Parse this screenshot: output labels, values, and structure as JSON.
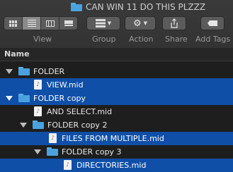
{
  "window": {
    "title": "CAN WIN 11 DO THIS PLZZZ"
  },
  "toolbar": {
    "view_label": "View",
    "group_label": "Group",
    "action_label": "Action",
    "share_label": "Share",
    "add_tags_label": "Add Tags",
    "view_modes": [
      "icon-view",
      "list-view",
      "column-view",
      "gallery-view"
    ],
    "active_view": "list-view"
  },
  "list": {
    "column_header": "Name",
    "rows": [
      {
        "name": "FOLDER",
        "kind": "folder",
        "depth": 0,
        "expanded": true,
        "selected": false
      },
      {
        "name": "VIEW.mid",
        "kind": "file",
        "depth": 1,
        "selected": true
      },
      {
        "name": "FOLDER copy",
        "kind": "folder",
        "depth": 0,
        "expanded": true,
        "selected": true
      },
      {
        "name": "AND SELECT.mid",
        "kind": "file",
        "depth": 1,
        "selected": false
      },
      {
        "name": "FOLDER copy 2",
        "kind": "folder",
        "depth": 1,
        "expanded": true,
        "selected": false
      },
      {
        "name": "FILES FROM MULTIPLE.mid",
        "kind": "file",
        "depth": 2,
        "selected": true
      },
      {
        "name": "FOLDER copy 3",
        "kind": "folder",
        "depth": 2,
        "expanded": true,
        "selected": false
      },
      {
        "name": "DIRECTORIES.mid",
        "kind": "file",
        "depth": 3,
        "selected": true
      }
    ]
  },
  "colors": {
    "selection": "#0f4fa8",
    "folder": "#49a2de",
    "background": "#1e1e1e"
  }
}
